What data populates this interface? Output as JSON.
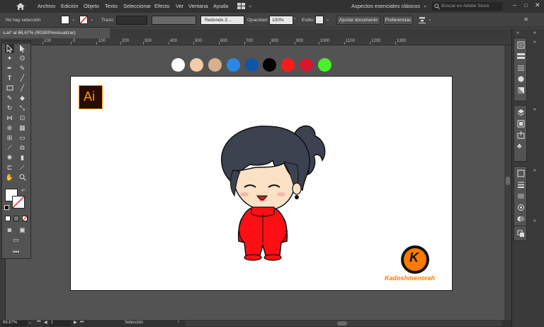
{
  "menubar": {
    "items": [
      "Archivo",
      "Edición",
      "Objeto",
      "Texto",
      "Seleccionar",
      "Efecto",
      "Ver",
      "Ventana",
      "Ayuda"
    ],
    "workspace": "Aspectos esenciales clásicos",
    "stock_placeholder": "Buscar en Adobe Stock"
  },
  "control": {
    "selection_status": "No hay selección",
    "stroke_label": "Trazo:",
    "brush_value": "Redondo 3 ...",
    "opacity_label": "Opacidad:",
    "opacity_value": "100%",
    "style_label": "Estilo:",
    "fit_button": "Ajustar documento",
    "prefs_button": "Preferencias"
  },
  "document": {
    "tab_title": "s.ai* al 66,67% (RGB/Previsualizar)",
    "close_glyph": "×"
  },
  "ruler": {
    "labels": [
      "100",
      "0",
      "100",
      "200",
      "300",
      "400",
      "500",
      "600",
      "700",
      "800",
      "900",
      "1000",
      "1100",
      "1200",
      "1300"
    ]
  },
  "status": {
    "zoom": "66,67%",
    "artboard": "1",
    "tool": "Selección"
  },
  "palette": {
    "colors": [
      "#ffffff",
      "#f2cda7",
      "#d9b08c",
      "#2b87e3",
      "#0d57a8",
      "#000000",
      "#ff1a1a",
      "#d6162e",
      "#4cef2c"
    ]
  },
  "logos": {
    "ai_text": "Ai",
    "k_letter": "K",
    "signature": "Kadoshmenorah"
  },
  "colors": {
    "ai_bg": "#2a0b00",
    "ai_fg": "#ff9a00",
    "jacket": "#ff0f14",
    "hair": "#3d4250",
    "skin": "#fbe1c6"
  }
}
